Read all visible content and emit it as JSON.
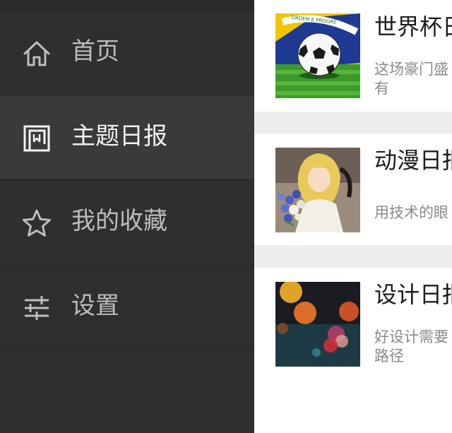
{
  "drawer": {
    "items": [
      {
        "label": "首页",
        "icon": "home-icon",
        "selected": false
      },
      {
        "label": "主题日报",
        "icon": "topic-daily-icon",
        "selected": true
      },
      {
        "label": "我的收藏",
        "icon": "star-icon",
        "selected": false
      },
      {
        "label": "设置",
        "icon": "settings-sliders-icon",
        "selected": false
      }
    ]
  },
  "feed": {
    "cards": [
      {
        "title": "世界杯日",
        "summary_line1": "这场豪门盛",
        "summary_line2": "有",
        "thumb": "soccer-ball-brazil-flag"
      },
      {
        "title": "动漫日报",
        "summary_line1": "用技术的眼",
        "summary_line2": "",
        "thumb": "anime-character-with-flowers"
      },
      {
        "title": "设计日报",
        "summary_line1": "好设计需要",
        "summary_line2": "路径",
        "thumb": "bokeh-lights"
      }
    ]
  },
  "colors": {
    "drawer_bg": "#2f2f2f",
    "drawer_selected_bg": "#3a3a3a",
    "feed_bg": "#eeeeee"
  }
}
